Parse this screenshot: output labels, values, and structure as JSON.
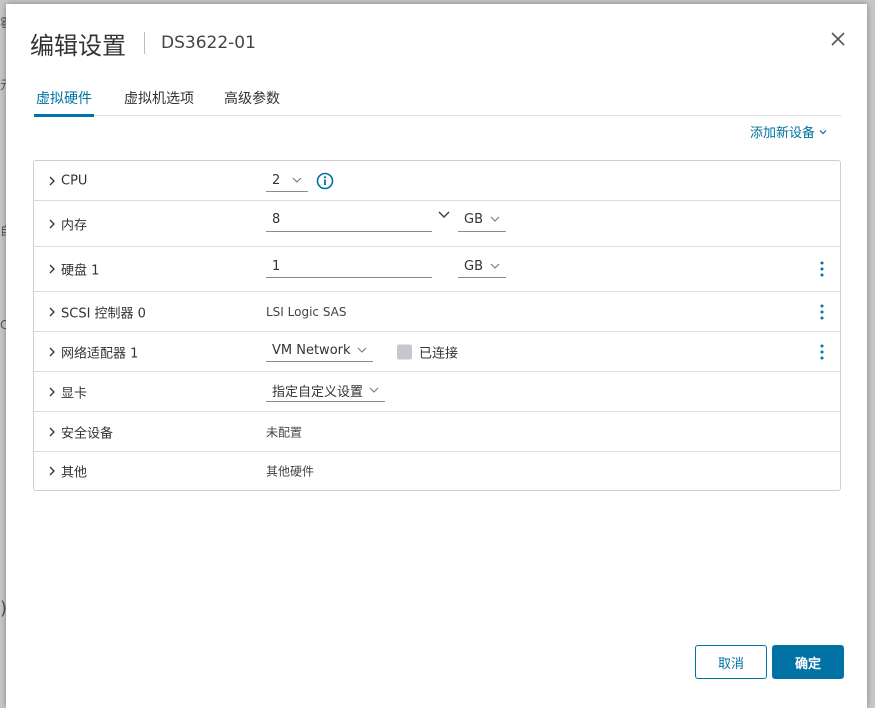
{
  "dialog": {
    "title": "编辑设置",
    "vm_name": "DS3622-01"
  },
  "tabs": [
    {
      "label": "虚拟硬件",
      "active": true
    },
    {
      "label": "虚拟机选项",
      "active": false
    },
    {
      "label": "高级参数",
      "active": false
    }
  ],
  "add_device": {
    "label": "添加新设备"
  },
  "hardware": {
    "cpu": {
      "label": "CPU",
      "value": "2"
    },
    "memory": {
      "label": "内存",
      "value": "8",
      "unit": "GB"
    },
    "disk": {
      "label": "硬盘 1",
      "value": "1",
      "unit": "GB"
    },
    "scsi": {
      "label": "SCSI 控制器 0",
      "value": "LSI Logic SAS"
    },
    "network": {
      "label": "网络适配器 1",
      "value": "VM Network",
      "connected_label": "已连接",
      "connected": false
    },
    "video": {
      "label": "显卡",
      "value": "指定自定义设置"
    },
    "security": {
      "label": "安全设备",
      "value": "未配置"
    },
    "other": {
      "label": "其他",
      "value": "其他硬件"
    }
  },
  "footer": {
    "cancel_label": "取消",
    "ok_label": "确定"
  },
  "colors": {
    "accent": "#0072a3",
    "checkbox": "#c5c9cd"
  }
}
